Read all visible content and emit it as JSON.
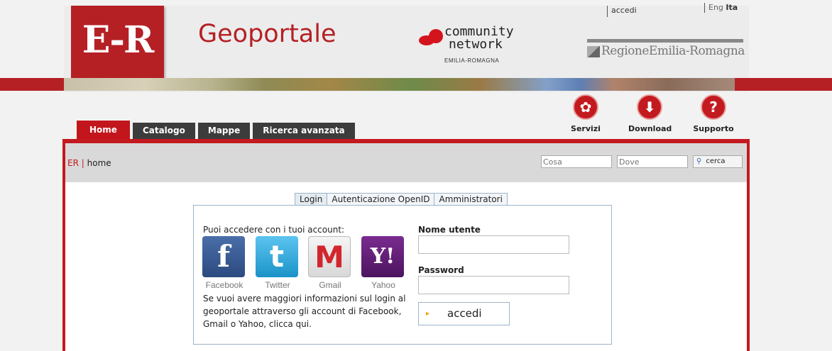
{
  "header": {
    "logo_text": "E-R",
    "site_title": "Geoportale",
    "community": {
      "line1": "community",
      "line2": "network",
      "line3": "EMILIA-ROMAGNA"
    },
    "region_logo": "RegioneEmilia-Romagna",
    "top_login": "accedi",
    "lang_eng": "Eng",
    "lang_ita": "Ita"
  },
  "nav": {
    "tabs": [
      {
        "label": "Home",
        "active": true
      },
      {
        "label": "Catalogo"
      },
      {
        "label": "Mappe"
      },
      {
        "label": "Ricerca avanzata"
      }
    ]
  },
  "tools": [
    {
      "label": "Servizi",
      "icon": "services-icon"
    },
    {
      "label": "Download",
      "icon": "download-icon"
    },
    {
      "label": "Supporto",
      "icon": "support-icon"
    }
  ],
  "breadcrumb": {
    "root": "ER",
    "sep": "|",
    "current": "home"
  },
  "search": {
    "cosa_placeholder": "Cosa",
    "dove_placeholder": "Dove",
    "button": "cerca"
  },
  "login": {
    "tabs": [
      "Login",
      "Autenticazione OpenID",
      "Amministratori"
    ],
    "intro": "Puoi accedere con i tuoi account:",
    "providers": [
      {
        "label": "Facebook",
        "glyph": "f"
      },
      {
        "label": "Twitter",
        "glyph": "t"
      },
      {
        "label": "Gmail",
        "glyph": "M"
      },
      {
        "label": "Yahoo",
        "glyph": "Y!"
      }
    ],
    "info": "Se vuoi avere maggiori informazioni sul login al geoportale attraverso gli account di Facebook, Gmail o Yahoo, clicca qui.",
    "username_label": "Nome utente",
    "password_label": "Password",
    "submit": "accedi"
  },
  "colors": {
    "brand_red": "#c31a1f",
    "tab_dark": "#3c3c3c"
  }
}
